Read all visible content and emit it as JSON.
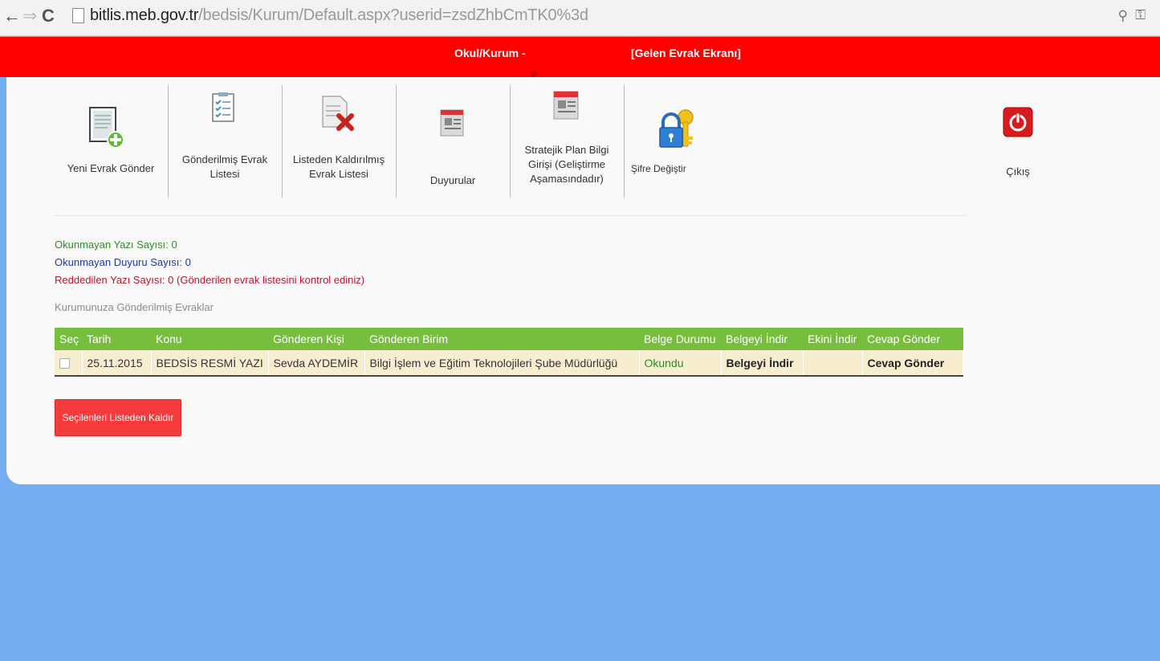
{
  "browser": {
    "url_host": "bitlis.meb.gov.tr",
    "url_path": "/bedsis/Kurum/Default.aspx?userid=zsdZhbCmTK0%3d"
  },
  "header": {
    "title_left": "Okul/Kurum -",
    "title_right": "[Gelen Evrak Ekranı]"
  },
  "menu": [
    {
      "label": "Yeni Evrak Gönder",
      "icon": "new-document-icon"
    },
    {
      "label": "Gönderilmiş Evrak Listesi",
      "icon": "sent-list-icon"
    },
    {
      "label": "Listeden Kaldırılmış Evrak Listesi",
      "icon": "removed-list-icon"
    },
    {
      "label": "Duyurular",
      "icon": "announcements-icon"
    },
    {
      "label": "Stratejik Plan Bilgi Girişi (Geliştirme Aşamasındadır)",
      "icon": "strategic-plan-icon"
    },
    {
      "label": "Şifre Değiştir",
      "icon": "password-keys-icon"
    },
    {
      "label": "Çıkış",
      "icon": "power-icon"
    }
  ],
  "stats": {
    "unread_docs": "Okunmayan Yazı Sayısı: 0",
    "unread_announcements": "Okunmayan Duyuru Sayısı: 0",
    "rejected": "Reddedilen Yazı Sayısı: 0 (Gönderilen evrak listesini kontrol ediniz)"
  },
  "section_title": "Kurumunuza Gönderilmiş Evraklar",
  "table": {
    "columns": [
      "Seç",
      "Tarih",
      "Konu",
      "Gönderen Kişi",
      "Gönderen Birim",
      "Belge Durumu",
      "Belgeyi İndir",
      "Ekini İndir",
      "Cevap Gönder"
    ],
    "rows": [
      {
        "date": "25.11.2015",
        "subject": "BEDSİS RESMİ YAZI",
        "sender": "Sevda AYDEMİR",
        "unit": "Bilgi İşlem ve Eğitim Teknolojileri Şube Müdürlüğü",
        "status": "Okundu",
        "download": "Belgeyi İndir",
        "attachment": "",
        "reply": "Cevap Gönder"
      }
    ]
  },
  "remove_button": "Seçilenleri Listeden Kaldır",
  "colors": {
    "header_red": "#fe0000",
    "table_header_green": "#77be3f",
    "row_bg": "#f7edcf",
    "page_bg_blue": "#74aef0"
  }
}
